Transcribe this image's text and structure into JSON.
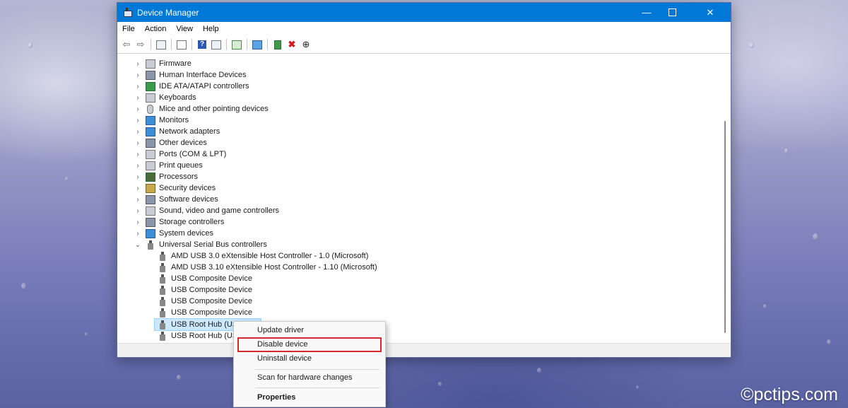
{
  "window": {
    "title": "Device Manager",
    "controls": {
      "minimize": "—",
      "close": "✕"
    }
  },
  "menu": {
    "items": [
      "File",
      "Action",
      "View",
      "Help"
    ]
  },
  "toolbar": {
    "icons": [
      "back-arrow-icon",
      "forward-arrow-icon",
      "show-hide-console-tree-icon",
      "properties-sheet-icon",
      "help-icon",
      "action-pane-icon",
      "scan-hardware-icon",
      "monitor-icon",
      "update-driver-icon",
      "uninstall-device-icon",
      "disable-device-icon"
    ],
    "glyphs": {
      "back": "⇦",
      "forward": "⇨",
      "uninstall": "✖",
      "disable": "⊕"
    }
  },
  "tree": {
    "categories": [
      "Firmware",
      "Human Interface Devices",
      "IDE ATA/ATAPI controllers",
      "Keyboards",
      "Mice and other pointing devices",
      "Monitors",
      "Network adapters",
      "Other devices",
      "Ports (COM & LPT)",
      "Print queues",
      "Processors",
      "Security devices",
      "Software devices",
      "Sound, video and game controllers",
      "Storage controllers",
      "System devices",
      "Universal Serial Bus controllers"
    ],
    "usb_children": [
      "AMD USB 3.0 eXtensible Host Controller - 1.0 (Microsoft)",
      "AMD USB 3.10 eXtensible Host Controller - 1.10 (Microsoft)",
      "USB Composite Device",
      "USB Composite Device",
      "USB Composite Device",
      "USB Composite Device",
      "USB Root Hub (USB 3.0)",
      "USB Root Hub (USB 3.0)"
    ],
    "collapsed_glyph": "›",
    "expanded_glyph": "⌄",
    "selected_item": "USB Root Hub (USB 3.0)"
  },
  "context_menu": {
    "items": [
      "Update driver",
      "Disable device",
      "Uninstall device",
      "Scan for hardware changes",
      "Properties"
    ],
    "highlighted": "Disable device"
  },
  "watermark": "©pctips.com"
}
